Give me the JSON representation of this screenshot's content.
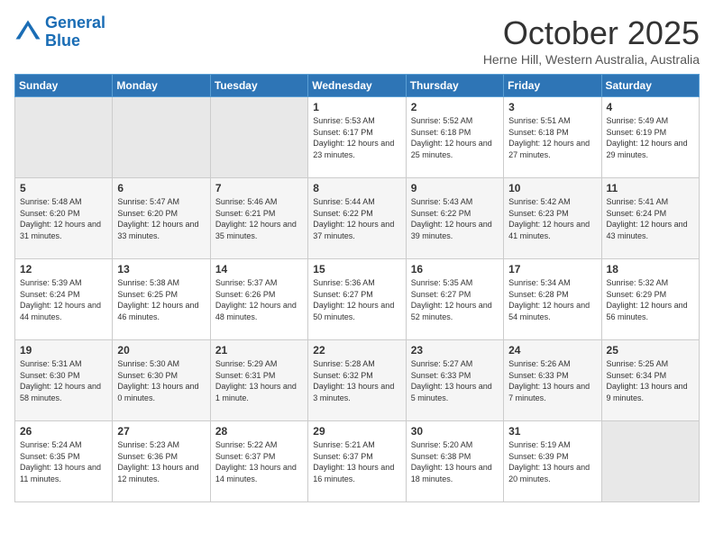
{
  "header": {
    "logo_line1": "General",
    "logo_line2": "Blue",
    "month": "October 2025",
    "location": "Herne Hill, Western Australia, Australia"
  },
  "weekdays": [
    "Sunday",
    "Monday",
    "Tuesday",
    "Wednesday",
    "Thursday",
    "Friday",
    "Saturday"
  ],
  "weeks": [
    [
      {
        "day": "",
        "sunrise": "",
        "sunset": "",
        "daylight": ""
      },
      {
        "day": "",
        "sunrise": "",
        "sunset": "",
        "daylight": ""
      },
      {
        "day": "",
        "sunrise": "",
        "sunset": "",
        "daylight": ""
      },
      {
        "day": "1",
        "sunrise": "Sunrise: 5:53 AM",
        "sunset": "Sunset: 6:17 PM",
        "daylight": "Daylight: 12 hours and 23 minutes."
      },
      {
        "day": "2",
        "sunrise": "Sunrise: 5:52 AM",
        "sunset": "Sunset: 6:18 PM",
        "daylight": "Daylight: 12 hours and 25 minutes."
      },
      {
        "day": "3",
        "sunrise": "Sunrise: 5:51 AM",
        "sunset": "Sunset: 6:18 PM",
        "daylight": "Daylight: 12 hours and 27 minutes."
      },
      {
        "day": "4",
        "sunrise": "Sunrise: 5:49 AM",
        "sunset": "Sunset: 6:19 PM",
        "daylight": "Daylight: 12 hours and 29 minutes."
      }
    ],
    [
      {
        "day": "5",
        "sunrise": "Sunrise: 5:48 AM",
        "sunset": "Sunset: 6:20 PM",
        "daylight": "Daylight: 12 hours and 31 minutes."
      },
      {
        "day": "6",
        "sunrise": "Sunrise: 5:47 AM",
        "sunset": "Sunset: 6:20 PM",
        "daylight": "Daylight: 12 hours and 33 minutes."
      },
      {
        "day": "7",
        "sunrise": "Sunrise: 5:46 AM",
        "sunset": "Sunset: 6:21 PM",
        "daylight": "Daylight: 12 hours and 35 minutes."
      },
      {
        "day": "8",
        "sunrise": "Sunrise: 5:44 AM",
        "sunset": "Sunset: 6:22 PM",
        "daylight": "Daylight: 12 hours and 37 minutes."
      },
      {
        "day": "9",
        "sunrise": "Sunrise: 5:43 AM",
        "sunset": "Sunset: 6:22 PM",
        "daylight": "Daylight: 12 hours and 39 minutes."
      },
      {
        "day": "10",
        "sunrise": "Sunrise: 5:42 AM",
        "sunset": "Sunset: 6:23 PM",
        "daylight": "Daylight: 12 hours and 41 minutes."
      },
      {
        "day": "11",
        "sunrise": "Sunrise: 5:41 AM",
        "sunset": "Sunset: 6:24 PM",
        "daylight": "Daylight: 12 hours and 43 minutes."
      }
    ],
    [
      {
        "day": "12",
        "sunrise": "Sunrise: 5:39 AM",
        "sunset": "Sunset: 6:24 PM",
        "daylight": "Daylight: 12 hours and 44 minutes."
      },
      {
        "day": "13",
        "sunrise": "Sunrise: 5:38 AM",
        "sunset": "Sunset: 6:25 PM",
        "daylight": "Daylight: 12 hours and 46 minutes."
      },
      {
        "day": "14",
        "sunrise": "Sunrise: 5:37 AM",
        "sunset": "Sunset: 6:26 PM",
        "daylight": "Daylight: 12 hours and 48 minutes."
      },
      {
        "day": "15",
        "sunrise": "Sunrise: 5:36 AM",
        "sunset": "Sunset: 6:27 PM",
        "daylight": "Daylight: 12 hours and 50 minutes."
      },
      {
        "day": "16",
        "sunrise": "Sunrise: 5:35 AM",
        "sunset": "Sunset: 6:27 PM",
        "daylight": "Daylight: 12 hours and 52 minutes."
      },
      {
        "day": "17",
        "sunrise": "Sunrise: 5:34 AM",
        "sunset": "Sunset: 6:28 PM",
        "daylight": "Daylight: 12 hours and 54 minutes."
      },
      {
        "day": "18",
        "sunrise": "Sunrise: 5:32 AM",
        "sunset": "Sunset: 6:29 PM",
        "daylight": "Daylight: 12 hours and 56 minutes."
      }
    ],
    [
      {
        "day": "19",
        "sunrise": "Sunrise: 5:31 AM",
        "sunset": "Sunset: 6:30 PM",
        "daylight": "Daylight: 12 hours and 58 minutes."
      },
      {
        "day": "20",
        "sunrise": "Sunrise: 5:30 AM",
        "sunset": "Sunset: 6:30 PM",
        "daylight": "Daylight: 13 hours and 0 minutes."
      },
      {
        "day": "21",
        "sunrise": "Sunrise: 5:29 AM",
        "sunset": "Sunset: 6:31 PM",
        "daylight": "Daylight: 13 hours and 1 minute."
      },
      {
        "day": "22",
        "sunrise": "Sunrise: 5:28 AM",
        "sunset": "Sunset: 6:32 PM",
        "daylight": "Daylight: 13 hours and 3 minutes."
      },
      {
        "day": "23",
        "sunrise": "Sunrise: 5:27 AM",
        "sunset": "Sunset: 6:33 PM",
        "daylight": "Daylight: 13 hours and 5 minutes."
      },
      {
        "day": "24",
        "sunrise": "Sunrise: 5:26 AM",
        "sunset": "Sunset: 6:33 PM",
        "daylight": "Daylight: 13 hours and 7 minutes."
      },
      {
        "day": "25",
        "sunrise": "Sunrise: 5:25 AM",
        "sunset": "Sunset: 6:34 PM",
        "daylight": "Daylight: 13 hours and 9 minutes."
      }
    ],
    [
      {
        "day": "26",
        "sunrise": "Sunrise: 5:24 AM",
        "sunset": "Sunset: 6:35 PM",
        "daylight": "Daylight: 13 hours and 11 minutes."
      },
      {
        "day": "27",
        "sunrise": "Sunrise: 5:23 AM",
        "sunset": "Sunset: 6:36 PM",
        "daylight": "Daylight: 13 hours and 12 minutes."
      },
      {
        "day": "28",
        "sunrise": "Sunrise: 5:22 AM",
        "sunset": "Sunset: 6:37 PM",
        "daylight": "Daylight: 13 hours and 14 minutes."
      },
      {
        "day": "29",
        "sunrise": "Sunrise: 5:21 AM",
        "sunset": "Sunset: 6:37 PM",
        "daylight": "Daylight: 13 hours and 16 minutes."
      },
      {
        "day": "30",
        "sunrise": "Sunrise: 5:20 AM",
        "sunset": "Sunset: 6:38 PM",
        "daylight": "Daylight: 13 hours and 18 minutes."
      },
      {
        "day": "31",
        "sunrise": "Sunrise: 5:19 AM",
        "sunset": "Sunset: 6:39 PM",
        "daylight": "Daylight: 13 hours and 20 minutes."
      },
      {
        "day": "",
        "sunrise": "",
        "sunset": "",
        "daylight": ""
      }
    ]
  ]
}
